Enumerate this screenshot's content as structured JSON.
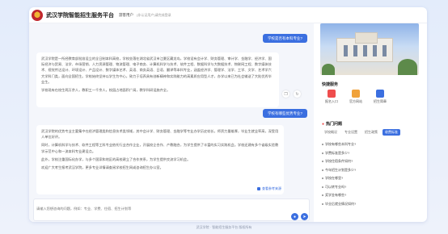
{
  "header": {
    "title": "武汉学院智能招生服务平台",
    "user_name": "游客用户",
    "user_sub": "(非认证用户)请完成登录"
  },
  "chat": {
    "messages": [
      {
        "role": "user",
        "text": "学校是否有本科专业?"
      },
      {
        "role": "bot",
        "paragraphs": [
          "武汉学院是一所经教育部批准设立的全日制本科高校，学校坐落在湖北省武汉市江夏区藏龙岛，学校设有会计学、财务管理、审计学、金融学、经济学、国际经济与贸易、法学、市场营销、人力资源管理、物流管理、电子商务、计算机科学与技术、软件工程、数据科学与大数据技术、物联网工程、数字媒体技术、视觉传达设计、环境设计、产品设计、数字媒体艺术、英语、商务英语、日语、翻译等本科专业，涵盖经济学、管理学、法学、工学、文学、艺术学六大学科门类，面向全国招生。学校始终坚持以学生为中心，致力于培养具有创新精神和实践能力的高素质应用型人才，办学以来已为社会输送了大批优秀毕业生。",
          "学校现有在校生两万余人，教职工一千余人，校园占地面积广阔，教学科研设施齐全。"
        ]
      },
      {
        "role": "user",
        "text": "学校有哪些优势专业?"
      },
      {
        "role": "bot",
        "paragraphs": [
          "武汉学院的优势专业主要集中在经济管理类和信息技术类领域，其中会计学、财务管理、金融学等专业办学历史较长，师资力量雄厚，毕业生就业率高，深受用人单位好评。",
          "同时，计算机科学与技术、软件工程等工科专业依托行业合作企业，开展校企合作、产教融合，为学生提供了丰富的实习实践机会。学校还建有多个省级实验教学示范中心和一流本科专业建设点。",
          "此外，学校注重国际化办学，与多个国家和地区的高校建立了合作关系，为学生提供交流学习机会。",
          "欢迎广大考生报考武汉学院，更多专业详情请查阅学校招生网或咨询招生办公室。"
        ],
        "source_label": "查看参考来源"
      }
    ],
    "composer": {
      "placeholder": "请输入您想咨询的问题，例如：专业、学费、住宿、招生计划等"
    }
  },
  "panel": {
    "campus_image": "campus-building-photo",
    "quick_access_title": "快捷服务",
    "quick_access": [
      {
        "label": "报名入口",
        "icon": "register-icon",
        "color": "#ef4d4d"
      },
      {
        "label": "官方网站",
        "icon": "globe-icon",
        "color": "#f0a23a"
      },
      {
        "label": "招生简章",
        "icon": "brochure-icon",
        "color": "#3b6fe0"
      }
    ],
    "hot_title": "热门问题",
    "tabs": [
      "学校概况",
      "专业设置",
      "招生政策",
      "收费标准"
    ],
    "active_tab": 3,
    "hot_questions": [
      "学校有哪些本科专业?",
      "学费标准是多少?",
      "学校住宿条件如何?",
      "今年招生计划是多少?",
      "学校在哪里?",
      "可以转专业吗?",
      "奖学金有哪些?",
      "毕业后就业情况如何?"
    ]
  },
  "footer": {
    "text": "武汉学院 · 智能招生服务平台 版权所有"
  },
  "colors": {
    "accent": "#3b6fe0",
    "user_bubble": "#3b6fe0",
    "chat_bg": "#f4f6fb"
  }
}
